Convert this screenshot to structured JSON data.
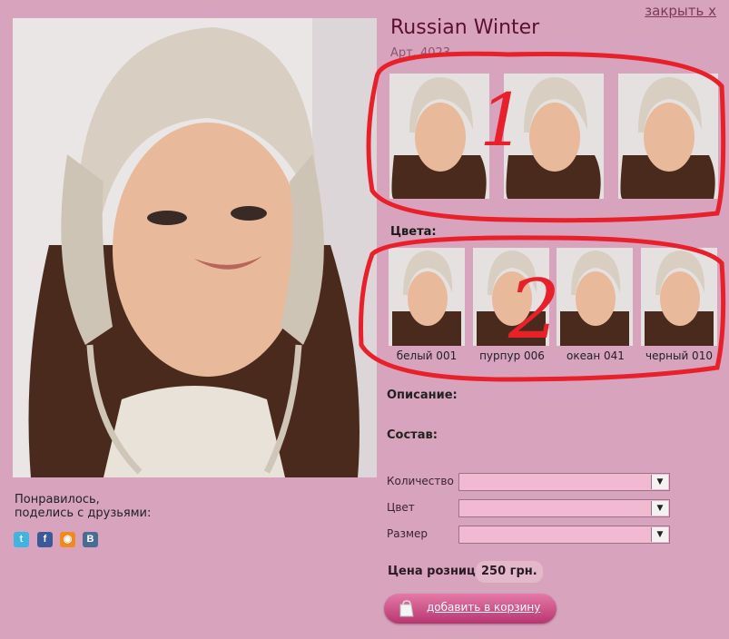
{
  "header": {
    "close_label": "закрыть х"
  },
  "product": {
    "title": "Russian Winter",
    "article": "Арт. 4023",
    "colors_label": "Цвета:",
    "description_label": "Описание:",
    "composition_label": "Состав:"
  },
  "colors": [
    {
      "name": "белый 001"
    },
    {
      "name": "пурпур 006"
    },
    {
      "name": "океан 041"
    },
    {
      "name": "черный 010"
    }
  ],
  "annotations": {
    "mark1": "1",
    "mark2": "2",
    "color": "#e8202a"
  },
  "share": {
    "line1": "Понравилось,",
    "line2": "поделись с друзьями:",
    "icons": [
      "twitter-icon",
      "facebook-icon",
      "rss-icon",
      "vkontakte-icon"
    ]
  },
  "form": {
    "quantity_label": "Количество",
    "color_label": "Цвет",
    "size_label": "Размер"
  },
  "price": {
    "label": "Цена розница:",
    "value": "250 грн."
  },
  "cart": {
    "button_label": "добавить в корзину"
  },
  "colors_palette": {
    "background": "#d7a3bd",
    "title": "#5c0f33",
    "button": "#c8457f"
  }
}
